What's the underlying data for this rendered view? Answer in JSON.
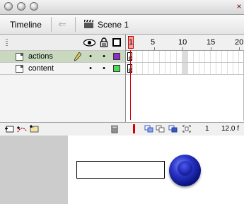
{
  "window": {
    "close_glyph": "×"
  },
  "toolbar": {
    "timeline_label": "Timeline",
    "scene_label": "Scene 1",
    "back_arrow": "⇐"
  },
  "layer_header": {
    "eye_icon": "eye-icon",
    "lock_icon": "lock-icon",
    "outline_icon": "outline-icon"
  },
  "layers": [
    {
      "name": "actions",
      "visible_dot": "•",
      "lock_dot": "•",
      "color": "#8e2ec8",
      "selected": true
    },
    {
      "name": "content",
      "visible_dot": "•",
      "lock_dot": "•",
      "color": "#4cd957",
      "selected": false
    }
  ],
  "ruler": {
    "labels": [
      "1",
      "5",
      "10",
      "15",
      "20"
    ]
  },
  "status": {
    "current_frame": "1",
    "fps": "12.0 f"
  },
  "colors": {
    "selected_row": "#c9d9c0",
    "playhead": "#cc0000"
  }
}
